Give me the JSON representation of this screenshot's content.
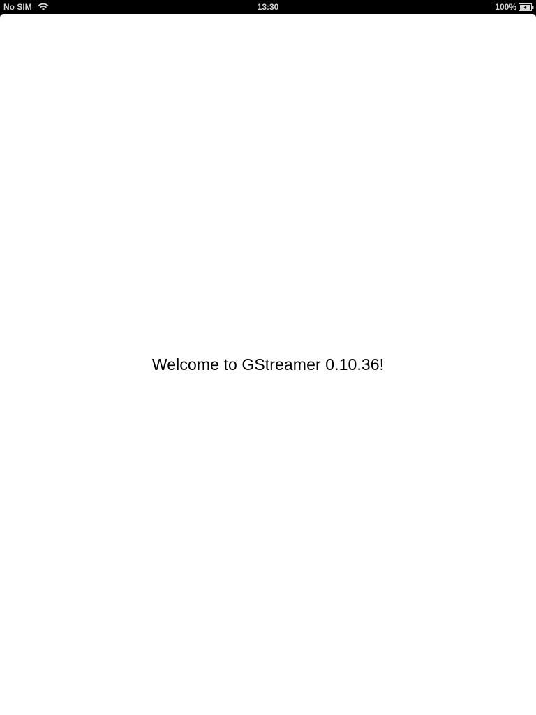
{
  "status_bar": {
    "carrier": "No SIM",
    "time": "13:30",
    "battery_percent": "100%",
    "battery_level": 1.0,
    "wifi_icon": "wifi-icon",
    "battery_icon": "battery-charging-icon"
  },
  "main": {
    "welcome_text": "Welcome to GStreamer 0.10.36!"
  },
  "colors": {
    "status_bar_bg": "#000000",
    "status_bar_text": "#d9d9d9",
    "screen_bg": "#ffffff",
    "text": "#000000"
  }
}
